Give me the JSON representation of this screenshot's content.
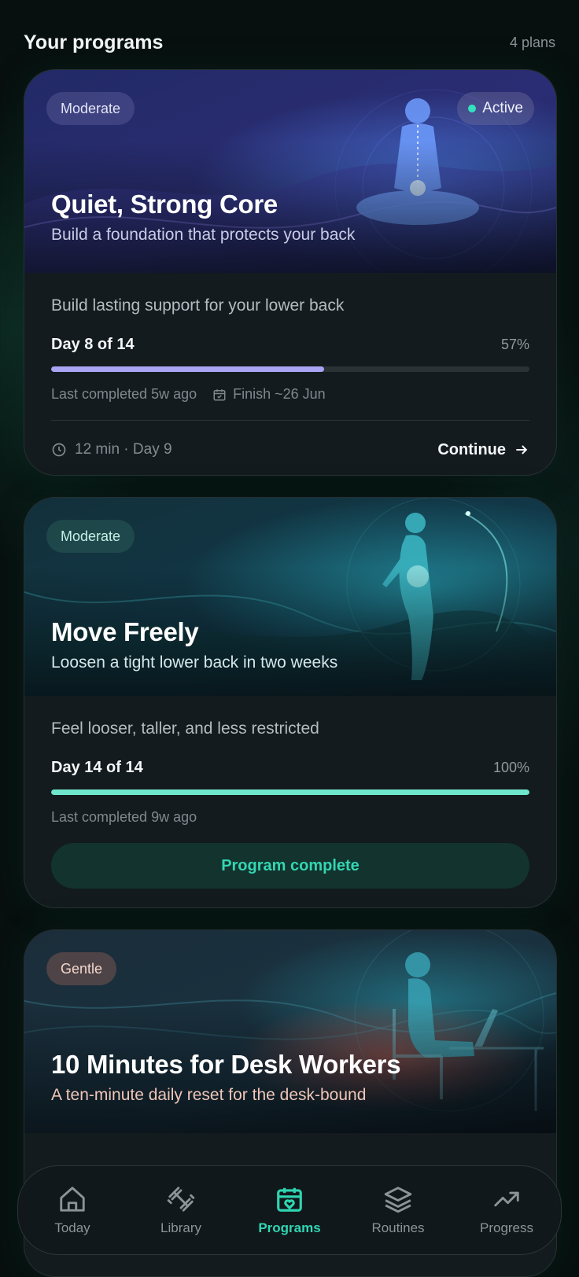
{
  "header": {
    "title": "Your programs",
    "count": "4 plans"
  },
  "programs": [
    {
      "level": "Moderate",
      "status": "Active",
      "title": "Quiet, Strong Core",
      "subtitle": "Build a foundation that protects your back",
      "description": "Build lasting support for your lower back",
      "day_label": "Day 8 of 14",
      "percent_label": "57%",
      "progress": 0.57,
      "last_completed": "Last completed 5w ago",
      "finish": "Finish ~26 Jun",
      "session": "12 min · Day 9",
      "action": "Continue"
    },
    {
      "level": "Moderate",
      "title": "Move Freely",
      "subtitle": "Loosen a tight lower back in two weeks",
      "description": "Feel looser, taller, and less restricted",
      "day_label": "Day 14 of 14",
      "percent_label": "100%",
      "progress": 1.0,
      "last_completed": "Last completed 9w ago",
      "action": "Program complete"
    },
    {
      "level": "Gentle",
      "title": "10 Minutes for Desk Workers",
      "subtitle": "A ten-minute daily reset for the desk-bound"
    }
  ],
  "colors": {
    "accent": "#2fd6b3",
    "progress_core": "#a9a4f3",
    "progress_move": "#6fe6cc"
  },
  "nav": {
    "items": [
      {
        "label": "Today",
        "icon": "home-icon"
      },
      {
        "label": "Library",
        "icon": "dumbbell-icon"
      },
      {
        "label": "Programs",
        "icon": "calendar-heart-icon",
        "active": true
      },
      {
        "label": "Routines",
        "icon": "layers-icon"
      },
      {
        "label": "Progress",
        "icon": "trending-up-icon"
      }
    ]
  }
}
